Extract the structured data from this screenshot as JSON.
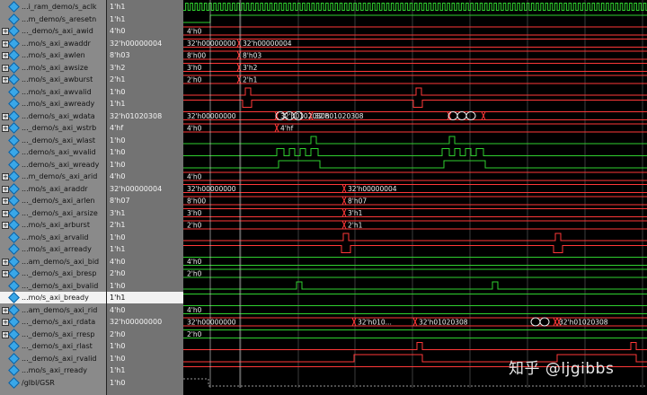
{
  "signals": [
    {
      "name": "...i_ram_demo/s_aclk",
      "value": "1'h1",
      "expand": false
    },
    {
      "name": "...m_demo/s_aresetn",
      "value": "1'h1",
      "expand": false
    },
    {
      "name": "..._demo/s_axi_awid",
      "value": "4'h0",
      "expand": true
    },
    {
      "name": "...mo/s_axi_awaddr",
      "value": "32'h00000004",
      "expand": true
    },
    {
      "name": "...mo/s_axi_awlen",
      "value": "8'h03",
      "expand": true
    },
    {
      "name": "...mo/s_axi_awsize",
      "value": "3'h2",
      "expand": true
    },
    {
      "name": "...mo/s_axi_awburst",
      "value": "2'h1",
      "expand": true
    },
    {
      "name": "...mo/s_axi_awvalid",
      "value": "1'h0",
      "expand": false
    },
    {
      "name": "...mo/s_axi_awready",
      "value": "1'h1",
      "expand": false
    },
    {
      "name": "...demo/s_axi_wdata",
      "value": "32'h01020308",
      "expand": true
    },
    {
      "name": "..._demo/s_axi_wstrb",
      "value": "4'hf",
      "expand": true
    },
    {
      "name": "..._demo/s_axi_wlast",
      "value": "1'h0",
      "expand": false
    },
    {
      "name": "...demo/s_axi_wvalid",
      "value": "1'h0",
      "expand": false
    },
    {
      "name": "...demo/s_axi_wready",
      "value": "1'h0",
      "expand": false
    },
    {
      "name": "...m_demo/s_axi_arid",
      "value": "4'h0",
      "expand": true
    },
    {
      "name": "...mo/s_axi_araddr",
      "value": "32'h00000004",
      "expand": true
    },
    {
      "name": "..._demo/s_axi_arlen",
      "value": "8'h07",
      "expand": true
    },
    {
      "name": "..._demo/s_axi_arsize",
      "value": "3'h1",
      "expand": true
    },
    {
      "name": "...mo/s_axi_arburst",
      "value": "2'h1",
      "expand": true
    },
    {
      "name": "...mo/s_axi_arvalid",
      "value": "1'h0",
      "expand": false
    },
    {
      "name": "...mo/s_axi_arready",
      "value": "1'h1",
      "expand": false
    },
    {
      "name": "...am_demo/s_axi_bid",
      "value": "4'h0",
      "expand": true
    },
    {
      "name": "..._demo/s_axi_bresp",
      "value": "2'h0",
      "expand": true
    },
    {
      "name": "..._demo/s_axi_bvalid",
      "value": "1'h0",
      "expand": false
    },
    {
      "name": "...mo/s_axi_bready",
      "value": "1'h1",
      "expand": false
    },
    {
      "name": "...am_demo/s_axi_rid",
      "value": "4'h0",
      "expand": true
    },
    {
      "name": "..._demo/s_axi_rdata",
      "value": "32'h00000000",
      "expand": true
    },
    {
      "name": "..._demo/s_axi_rresp",
      "value": "2'h0",
      "expand": true
    },
    {
      "name": "..._demo/s_axi_rlast",
      "value": "1'h0",
      "expand": false
    },
    {
      "name": "..._demo/s_axi_rvalid",
      "value": "1'h0",
      "expand": false
    },
    {
      "name": "...mo/s_axi_rready",
      "value": "1'h1",
      "expand": false
    },
    {
      "name": "/glbl/GSR",
      "value": "1'h0",
      "expand": false
    }
  ],
  "selected_index": 24,
  "bus_labels": [
    {
      "row": 2,
      "segments": [
        "4'h0"
      ]
    },
    {
      "row": 3,
      "segments": [
        "32'h00000000",
        "32'h00000004"
      ]
    },
    {
      "row": 4,
      "segments": [
        "8'h00",
        "8'h03"
      ]
    },
    {
      "row": 5,
      "segments": [
        "3'h0",
        "3'h2"
      ]
    },
    {
      "row": 6,
      "segments": [
        "2'h0",
        "2'h1"
      ]
    },
    {
      "row": 9,
      "segments": [
        "32'h00000000",
        "32'h01020308",
        "32'h01020308"
      ]
    },
    {
      "row": 10,
      "segments": [
        "4'h0",
        "4'hf"
      ]
    },
    {
      "row": 14,
      "segments": [
        "4'h0"
      ]
    },
    {
      "row": 15,
      "segments": [
        "32'h00000000",
        "32'h00000004"
      ]
    },
    {
      "row": 16,
      "segments": [
        "8'h00",
        "8'h07"
      ]
    },
    {
      "row": 17,
      "segments": [
        "3'h0",
        "3'h1"
      ]
    },
    {
      "row": 18,
      "segments": [
        "2'h0",
        "2'h1"
      ]
    },
    {
      "row": 21,
      "segments": [
        "4'h0"
      ]
    },
    {
      "row": 22,
      "segments": [
        "2'h0"
      ]
    },
    {
      "row": 25,
      "segments": [
        "4'h0"
      ]
    },
    {
      "row": 26,
      "segments": [
        "32'h00000000",
        "32'h010...",
        "32'h01020308",
        "32'h01020308"
      ]
    },
    {
      "row": 27,
      "segments": [
        "2'h0"
      ]
    }
  ],
  "colors": {
    "wave_green": "#2fd12f",
    "wave_red": "#ff3838",
    "cursor_line": "#d9d9d9",
    "gsr_dotted": "#9a9a9a"
  },
  "watermark": "知乎 @ljgibbs"
}
